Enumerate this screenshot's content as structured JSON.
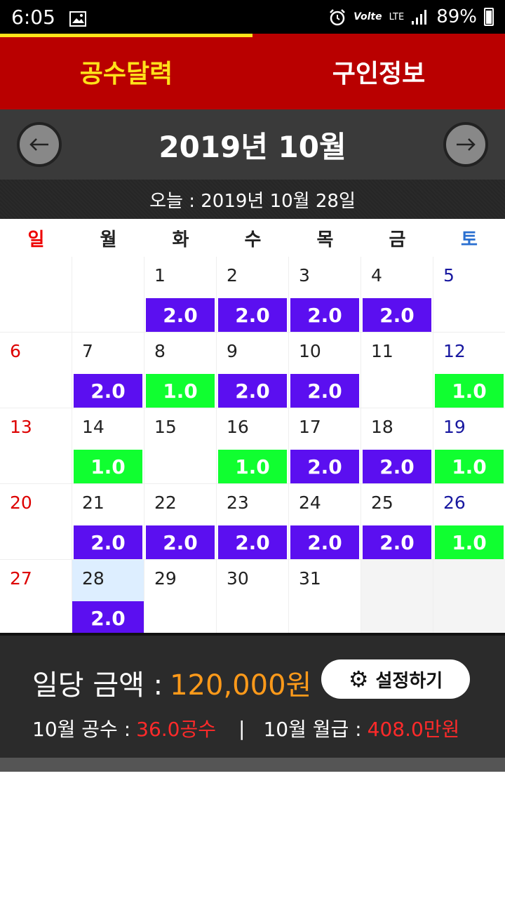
{
  "status": {
    "time": "6:05",
    "battery": "89%",
    "volte": "Volte",
    "network": "LTE"
  },
  "tabs": [
    {
      "label": "공수달력"
    },
    {
      "label": "구인정보"
    }
  ],
  "header": {
    "month_title": "2019년 10월",
    "today_label": "오늘 : 2019년 10월 28일"
  },
  "weekdays": [
    "일",
    "월",
    "화",
    "수",
    "목",
    "금",
    "토"
  ],
  "calendar": {
    "weeks": [
      [
        {
          "day": "",
          "work": ""
        },
        {
          "day": "",
          "work": ""
        },
        {
          "day": "1",
          "work": "2.0"
        },
        {
          "day": "2",
          "work": "2.0"
        },
        {
          "day": "3",
          "work": "2.0"
        },
        {
          "day": "4",
          "work": "2.0"
        },
        {
          "day": "5",
          "work": ""
        }
      ],
      [
        {
          "day": "6",
          "work": ""
        },
        {
          "day": "7",
          "work": "2.0"
        },
        {
          "day": "8",
          "work": "1.0"
        },
        {
          "day": "9",
          "work": "2.0"
        },
        {
          "day": "10",
          "work": "2.0"
        },
        {
          "day": "11",
          "work": ""
        },
        {
          "day": "12",
          "work": "1.0"
        }
      ],
      [
        {
          "day": "13",
          "work": ""
        },
        {
          "day": "14",
          "work": "1.0"
        },
        {
          "day": "15",
          "work": ""
        },
        {
          "day": "16",
          "work": "1.0"
        },
        {
          "day": "17",
          "work": "2.0"
        },
        {
          "day": "18",
          "work": "2.0"
        },
        {
          "day": "19",
          "work": "1.0"
        }
      ],
      [
        {
          "day": "20",
          "work": ""
        },
        {
          "day": "21",
          "work": "2.0"
        },
        {
          "day": "22",
          "work": "2.0"
        },
        {
          "day": "23",
          "work": "2.0"
        },
        {
          "day": "24",
          "work": "2.0"
        },
        {
          "day": "25",
          "work": "2.0"
        },
        {
          "day": "26",
          "work": "1.0"
        }
      ],
      [
        {
          "day": "27",
          "work": ""
        },
        {
          "day": "28",
          "work": "2.0",
          "today": true
        },
        {
          "day": "29",
          "work": ""
        },
        {
          "day": "30",
          "work": ""
        },
        {
          "day": "31",
          "work": ""
        },
        {
          "day": "",
          "work": "",
          "next_month": true
        },
        {
          "day": "",
          "work": "",
          "next_month": true
        }
      ]
    ]
  },
  "summary": {
    "daily_label": "일당 금액 :",
    "daily_amount": "120,000원",
    "settings_label": "설정하기",
    "month_workdays_label": "10월 공수 :",
    "month_workdays_value": "36.0공수",
    "separator": "|",
    "month_salary_label": "10월 월급 :",
    "month_salary_value": "408.0만원"
  },
  "colors": {
    "tab_bg": "#b90000",
    "active_tab": "#ffe11a",
    "work_2": "#5b0ff0",
    "work_1": "#10ff30",
    "amount": "#ff9a1a",
    "value_red": "#ff2a2a"
  }
}
